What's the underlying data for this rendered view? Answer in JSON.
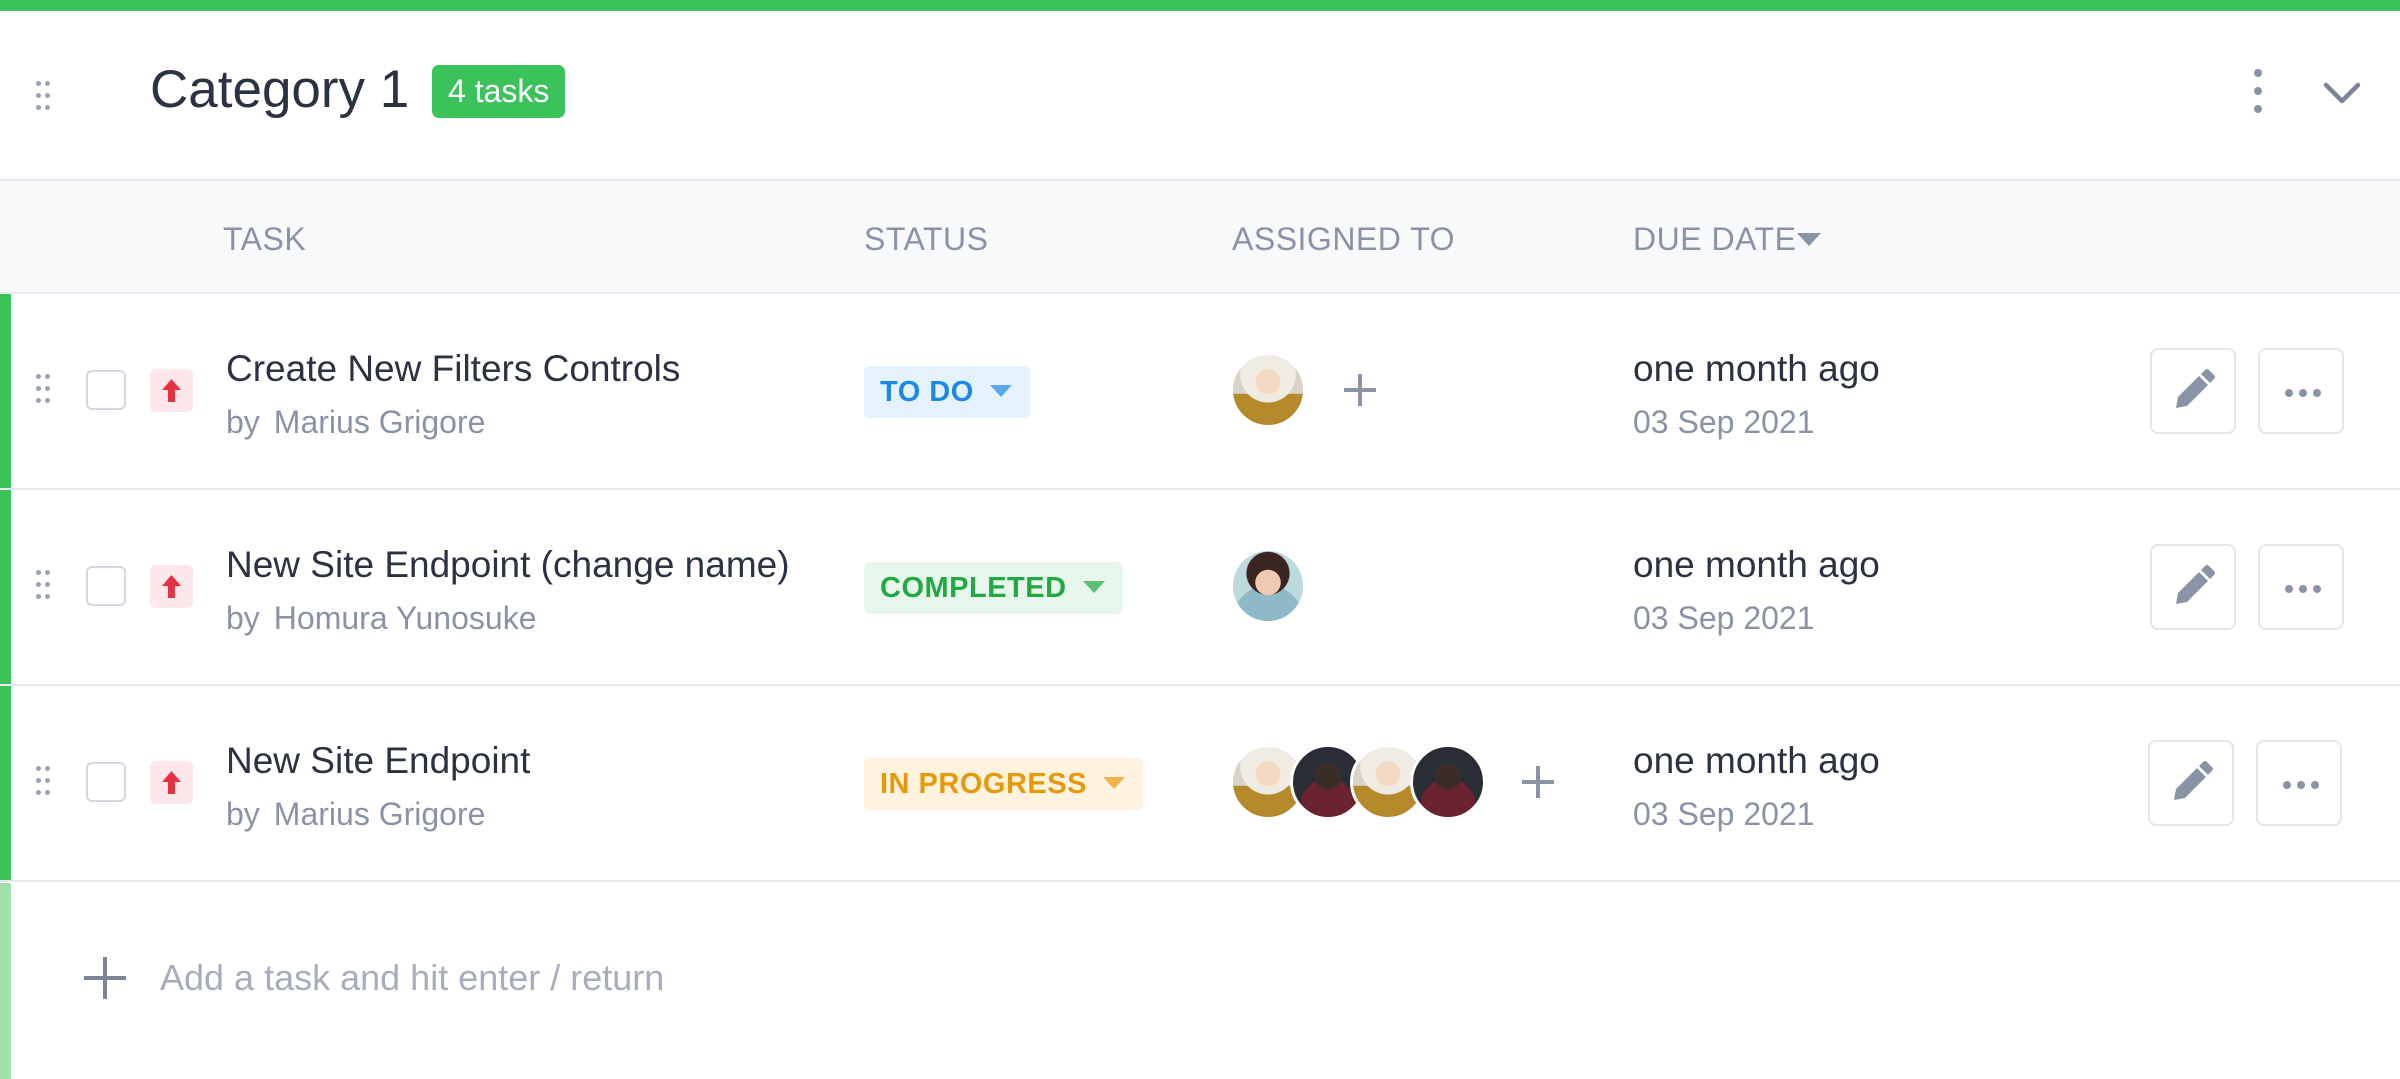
{
  "category": {
    "title": "Category 1",
    "task_count_badge": "4 tasks"
  },
  "columns": {
    "task": "TASK",
    "status": "STATUS",
    "assigned_to": "ASSIGNED TO",
    "due_date": "DUE DATE"
  },
  "colors": {
    "accent": "#3cc25a",
    "priority_high": "#e5323e",
    "todo_bg": "#e3f2fd",
    "todo_text": "#1e88e5",
    "completed_bg": "#e8f7ec",
    "completed_text": "#22a845",
    "in_progress_bg": "#fff3e0",
    "in_progress_text": "#e59a0b"
  },
  "tasks": [
    {
      "name": "Create New Filters Controls",
      "by_label": "by",
      "author": "Marius Grigore",
      "priority_icon": "arrow-up-icon",
      "status": "TO DO",
      "assignees": [
        "avatar-blonde-woman"
      ],
      "due_relative": "one month ago",
      "due_date": "03 Sep 2021"
    },
    {
      "name": "New Site Endpoint (change name)",
      "by_label": "by",
      "author": "Homura Yunosuke",
      "priority_icon": "arrow-up-icon",
      "status": "COMPLETED",
      "assignees": [
        "avatar-teal-woman"
      ],
      "due_relative": "one month ago",
      "due_date": "03 Sep 2021"
    },
    {
      "name": "New Site Endpoint",
      "by_label": "by",
      "author": "Marius Grigore",
      "priority_icon": "arrow-up-icon",
      "status": "IN PROGRESS",
      "assignees": [
        "avatar-blonde-woman",
        "avatar-dark-man",
        "avatar-blonde-woman",
        "avatar-dark-man"
      ],
      "due_relative": "one month ago",
      "due_date": "03 Sep 2021"
    }
  ],
  "add_task": {
    "placeholder": "Add a task and hit enter / return"
  }
}
